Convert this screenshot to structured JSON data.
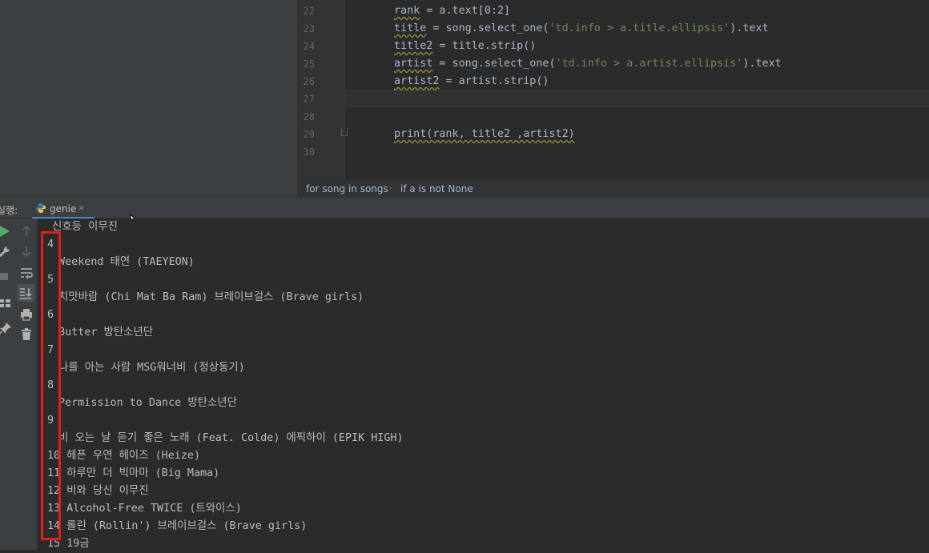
{
  "editor": {
    "line_numbers": [
      "22",
      "23",
      "24",
      "25",
      "26",
      "27",
      "28",
      "29",
      "30"
    ],
    "lines": [
      {
        "parts": [
          {
            "t": "rank",
            "w": true
          },
          {
            "t": " = a.text[0:2]"
          }
        ]
      },
      {
        "parts": [
          {
            "t": "title",
            "w": true
          },
          {
            "t": " = song.select_one("
          },
          {
            "t": "'td.info > a.title.ellipsis'",
            "s": true
          },
          {
            "t": ").text"
          }
        ]
      },
      {
        "parts": [
          {
            "t": "title2",
            "w": true
          },
          {
            "t": " = title.strip()"
          }
        ]
      },
      {
        "parts": [
          {
            "t": "artist",
            "w": true
          },
          {
            "t": " = song.select_one("
          },
          {
            "t": "'td.info > a.artist.ellipsis'",
            "s": true
          },
          {
            "t": ").text"
          }
        ]
      },
      {
        "parts": [
          {
            "t": "artist2",
            "w": true
          },
          {
            "t": " = artist.strip()"
          }
        ]
      },
      {
        "parts": []
      },
      {
        "parts": []
      },
      {
        "parts": [
          {
            "t": "print(rank, title2 ,artist2)",
            "w": true
          }
        ]
      },
      {
        "parts": []
      }
    ]
  },
  "breadcrumb": {
    "items": [
      "for song in songs",
      "if a is not None"
    ]
  },
  "run_panel": {
    "label": "실행:",
    "tab_label": "genie",
    "close_glyph": "×"
  },
  "console": {
    "lines": [
      "신호등 이무진",
      "4",
      " Weekend 태연 (TAEYEON)",
      "5",
      " 치맛바람 (Chi Mat Ba Ram) 브레이브걸스 (Brave girls)",
      "6",
      " Butter 방탄소년단",
      "7",
      " 나를 아는 사람 MSG워너비 (정상동기)",
      "8",
      " Permission to Dance 방탄소년단",
      "9",
      " 비 오는 날 듣기 좋은 노래 (Feat. Colde) 에픽하이 (EPIK HIGH)",
      "10 헤픈 우연 헤이즈 (Heize)",
      "11 하루만 더 빅마마 (Big Mama)",
      "12 비와 당신 이무진",
      "13 Alcohol-Free TWICE (트와이스)",
      "14 롤린 (Rollin') 브레이브걸스 (Brave girls)",
      "15 19금"
    ]
  },
  "colors": {
    "accent": "#4a88c7",
    "highlight_box": "#e01e1e",
    "string": "#6a8759"
  }
}
